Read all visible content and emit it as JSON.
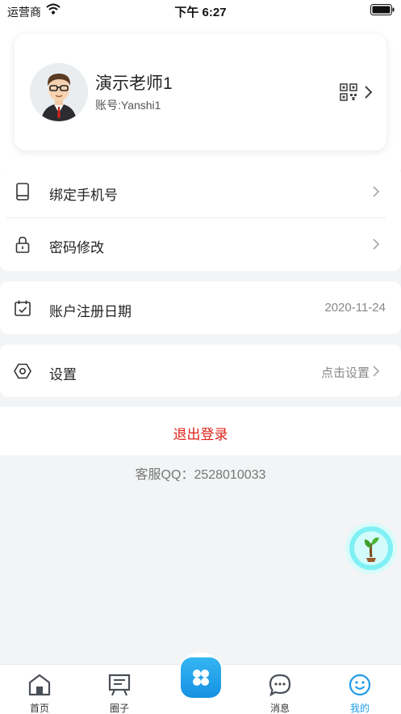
{
  "status_bar": {
    "carrier": "运营商",
    "time": "下午 6:27"
  },
  "profile": {
    "name": "演示老师1",
    "account": "账号:Yanshi1"
  },
  "menu": {
    "bind_phone": "绑定手机号",
    "change_password": "密码修改",
    "register_date_label": "账户注册日期",
    "register_date_value": "2020-11-24",
    "settings_label": "设置",
    "settings_value": "点击设置"
  },
  "logout_label": "退出登录",
  "customer_service": "客服QQ：2528010033",
  "tabs": {
    "home": "首页",
    "circle": "圈子",
    "messages": "消息",
    "mine": "我的"
  },
  "colors": {
    "accent": "#1e9be8",
    "logout": "#e0211a",
    "background": "#f2f4f5"
  }
}
